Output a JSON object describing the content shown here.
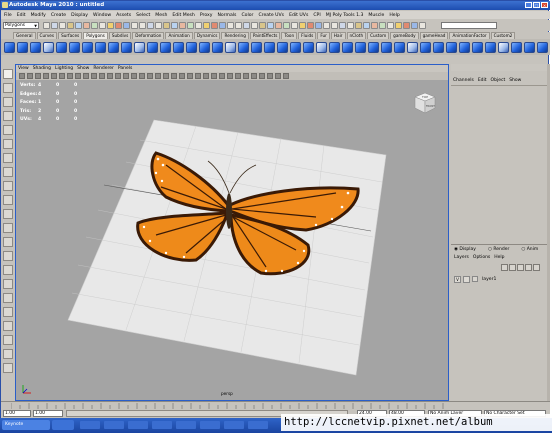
{
  "window": {
    "title": "Autodesk Maya 2010 : untitled",
    "controls": [
      "_",
      "□",
      "×"
    ]
  },
  "menubar": [
    "File",
    "Edit",
    "Modify",
    "Create",
    "Display",
    "Window",
    "Assets",
    "Select",
    "Mesh",
    "Edit Mesh",
    "Proxy",
    "Normals",
    "Color",
    "Create UVs",
    "Edit UVs",
    "CPI",
    "MJ Poly Tools 1.3",
    "Muscle",
    "Help"
  ],
  "status_line": {
    "mode": "Polygons"
  },
  "shelf_tabs": {
    "items": [
      "General",
      "Curves",
      "Surfaces",
      "Polygons",
      "Subdivs",
      "Deformation",
      "Animation",
      "Dynamics",
      "Rendering",
      "PaintEffects",
      "Toon",
      "Fluids",
      "Fur",
      "Hair",
      "nCloth",
      "Custom",
      "gameBody",
      "gameHead",
      "AnimationFactor",
      "Custom2"
    ],
    "active": "Polygons"
  },
  "viewport": {
    "menu": [
      "View",
      "Shading",
      "Lighting",
      "Show",
      "Renderer",
      "Panels"
    ],
    "hud": [
      {
        "label": "Verts:",
        "a": "4",
        "b": "0",
        "c": "0"
      },
      {
        "label": "Edges:",
        "a": "4",
        "b": "0",
        "c": "0"
      },
      {
        "label": "Faces:",
        "a": "1",
        "b": "0",
        "c": "0"
      },
      {
        "label": "Tris:",
        "a": "2",
        "b": "0",
        "c": "0"
      },
      {
        "label": "UVs:",
        "a": "4",
        "b": "0",
        "c": "0"
      }
    ],
    "camera_label": "persp",
    "viewcube": {
      "top": "TOP",
      "front": "FRONT"
    }
  },
  "channel_box": {
    "menu": [
      "Channels",
      "Edit",
      "Object",
      "Show"
    ]
  },
  "layer_editor": {
    "radios": [
      "Display",
      "Render",
      "Anim"
    ],
    "selected": "Display",
    "menu": [
      "Layers",
      "Options",
      "Help"
    ],
    "layers": [
      {
        "visible": "V",
        "name": "layer1"
      }
    ]
  },
  "time": {
    "current_left": "1.00",
    "start": "1.00",
    "end": "24.00",
    "range_end": "48.00",
    "anim_layer": "No Anim Layer",
    "character_set": "No Character Set"
  },
  "taskbar": {
    "start_label": "Keynote"
  },
  "watermark": "http://lccnetvip.pixnet.net/album",
  "colors": {
    "viewport_bg": "#a4a4a4",
    "plane": "#e9e9e9",
    "title_blue": "#1d4db0",
    "butterfly_orange": "#f08a1c"
  }
}
